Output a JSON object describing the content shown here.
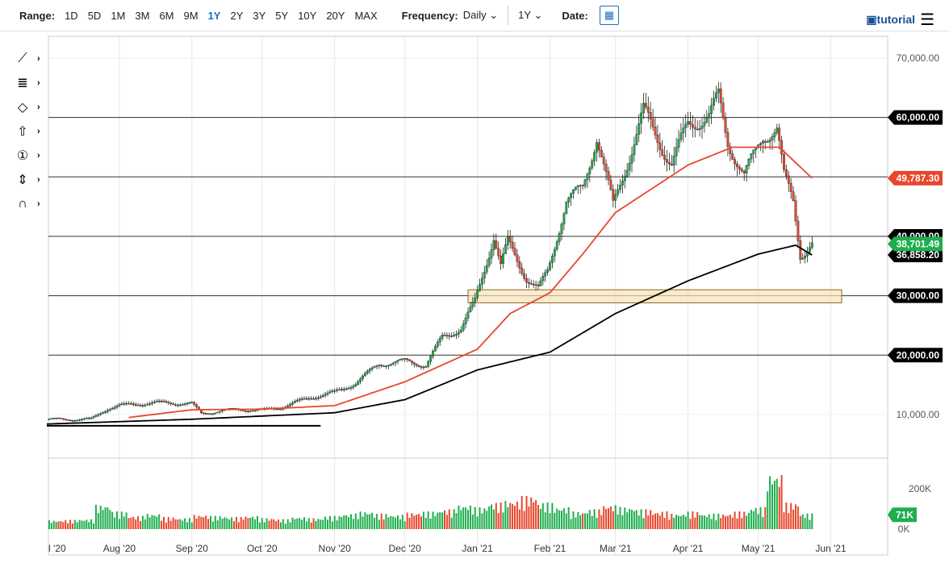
{
  "toolbar": {
    "range_label": "Range:",
    "ranges": [
      "1D",
      "5D",
      "1M",
      "3M",
      "6M",
      "9M",
      "1Y",
      "2Y",
      "3Y",
      "5Y",
      "10Y",
      "20Y",
      "MAX"
    ],
    "active_range": "1Y",
    "frequency_label": "Frequency:",
    "frequency": "Daily",
    "period": "1Y",
    "date_label": "Date:",
    "tutorial": "tutorial"
  },
  "tools": [
    {
      "name": "trendline-tool-icon",
      "glyph": "⟋"
    },
    {
      "name": "fib-tool-icon",
      "glyph": "≣"
    },
    {
      "name": "shape-tool-icon",
      "glyph": "◇"
    },
    {
      "name": "arrow-up-tool-icon",
      "glyph": "⇧"
    },
    {
      "name": "number-marker-icon",
      "glyph": "①"
    },
    {
      "name": "measure-tool-icon",
      "glyph": "⇕"
    },
    {
      "name": "magnet-icon",
      "glyph": "∩"
    }
  ],
  "chart_data": {
    "type": "candlestick",
    "x_labels": [
      "l '20",
      "Aug '20",
      "Sep '20",
      "Oct '20",
      "Nov '20",
      "Dec '20",
      "Jan '21",
      "Feb '21",
      "Mar '21",
      "Apr '21",
      "May '21",
      "Jun '21"
    ],
    "y_ticks": [
      "70,000.00",
      "60,000.00",
      "50,000.00",
      "40,000.00",
      "30,000.00",
      "20,000.00",
      "10,000.00"
    ],
    "ylim": [
      5000,
      72000
    ],
    "price_keypoints": [
      [
        0,
        9200
      ],
      [
        19,
        9200
      ],
      [
        26,
        11000
      ],
      [
        31,
        11500
      ],
      [
        47,
        12000
      ],
      [
        62,
        11800
      ],
      [
        66,
        10200
      ],
      [
        81,
        10900
      ],
      [
        92,
        10700
      ],
      [
        101,
        11300
      ],
      [
        112,
        12800
      ],
      [
        123,
        13700
      ],
      [
        132,
        15300
      ],
      [
        142,
        18500
      ],
      [
        153,
        19000
      ],
      [
        162,
        18300
      ],
      [
        169,
        23000
      ],
      [
        177,
        24500
      ],
      [
        183,
        29000
      ],
      [
        191,
        40000
      ],
      [
        194,
        35000
      ],
      [
        197,
        39000
      ],
      [
        205,
        33000
      ],
      [
        210,
        31000
      ],
      [
        214,
        34000
      ],
      [
        222,
        46000
      ],
      [
        229,
        48000
      ],
      [
        235,
        57000
      ],
      [
        242,
        45000
      ],
      [
        255,
        61000
      ],
      [
        267,
        52000
      ],
      [
        274,
        59000
      ],
      [
        283,
        60000
      ],
      [
        287,
        63500
      ],
      [
        291,
        56000
      ],
      [
        298,
        50000
      ],
      [
        306,
        57000
      ],
      [
        312,
        58000
      ],
      [
        315,
        50000
      ],
      [
        319,
        46000
      ],
      [
        322,
        37000
      ],
      [
        324,
        37500
      ],
      [
        327,
        38700
      ]
    ],
    "ma50": [
      [
        35,
        9500
      ],
      [
        62,
        10800
      ],
      [
        92,
        10900
      ],
      [
        123,
        11500
      ],
      [
        153,
        15500
      ],
      [
        184,
        21000
      ],
      [
        198,
        27000
      ],
      [
        215,
        30500
      ],
      [
        229,
        37000
      ],
      [
        243,
        44000
      ],
      [
        274,
        52000
      ],
      [
        293,
        55000
      ],
      [
        313,
        55000
      ],
      [
        327,
        49787
      ]
    ],
    "ma200": [
      [
        0,
        8400
      ],
      [
        62,
        9200
      ],
      [
        123,
        10300
      ],
      [
        153,
        12500
      ],
      [
        184,
        17500
      ],
      [
        215,
        20500
      ],
      [
        243,
        27000
      ],
      [
        274,
        32500
      ],
      [
        304,
        37000
      ],
      [
        320,
        38500
      ],
      [
        327,
        36858
      ]
    ],
    "horizontal_levels": [
      60000,
      50000,
      40000,
      30000,
      20000
    ],
    "support_zone": [
      28800,
      31000
    ],
    "trendline": [
      [
        0,
        8100
      ],
      [
        117,
        8100
      ]
    ],
    "price_tags": [
      {
        "label": "60,000.00",
        "value": 60000,
        "color": "#000000"
      },
      {
        "label": "49,787.30",
        "value": 49787,
        "color": "#e8472c"
      },
      {
        "label": "40,000.00",
        "value": 40000,
        "color": "#000000"
      },
      {
        "label": "36,858.20",
        "value": 36858,
        "color": "#000000"
      },
      {
        "label": "38,701.49",
        "value": 38701,
        "color": "#1fae4f"
      },
      {
        "label": "30,000.00",
        "value": 30000,
        "color": "#000000"
      },
      {
        "label": "20,000.00",
        "value": 20000,
        "color": "#000000"
      }
    ],
    "volume": {
      "ticks": [
        "200K",
        "0K"
      ],
      "last_label": "71K",
      "ylim": [
        0,
        260000
      ],
      "weekly": [
        40,
        42,
        45,
        110,
        80,
        60,
        70,
        55,
        50,
        65,
        60,
        55,
        60,
        50,
        45,
        55,
        50,
        60,
        70,
        80,
        70,
        65,
        75,
        80,
        90,
        110,
        100,
        120,
        130,
        150,
        120,
        100,
        80,
        90,
        110,
        100,
        90,
        80,
        70,
        80,
        70,
        70,
        80,
        100,
        250,
        120,
        71
      ]
    },
    "colors": {
      "up": "#1fae4f",
      "down": "#e8472c",
      "ma50": "#e8472c",
      "ma200": "#000000"
    }
  }
}
